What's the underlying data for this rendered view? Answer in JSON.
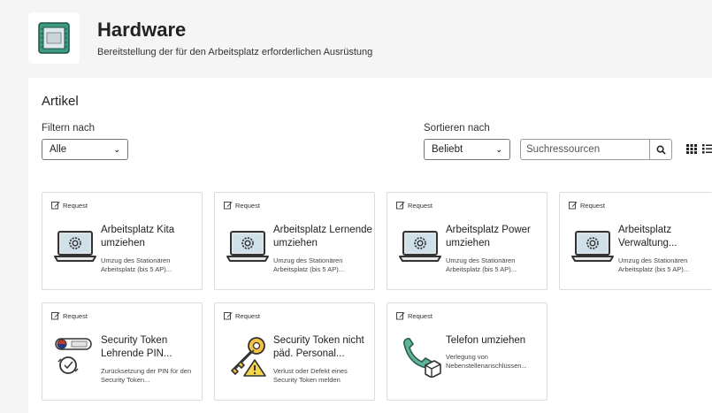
{
  "header": {
    "title": "Hardware",
    "subtitle": "Bereitstellung der für den Arbeitsplatz erforderlichen Ausrüstung",
    "icon": "chip-icon"
  },
  "section": {
    "title": "Artikel",
    "filter_label": "Filtern nach",
    "filter_value": "Alle",
    "sort_label": "Sortieren nach",
    "sort_value": "Beliebt",
    "search_placeholder": "Suchressourcen"
  },
  "cards": [
    {
      "badge": "Request",
      "title": "Arbeitsplatz Kita umziehen",
      "desc": "Umzug des Stationären Arbeitsplatz (bis 5 AP)...",
      "icon": "laptop-gear-icon"
    },
    {
      "badge": "Request",
      "title": "Arbeitsplatz Lernende umziehen",
      "desc": "Umzug des Stationären Arbeitsplatz (bis 5 AP)...",
      "icon": "laptop-gear-icon"
    },
    {
      "badge": "Request",
      "title": "Arbeitsplatz Power umziehen",
      "desc": "Umzug des Stationären Arbeitsplatz (bis 5 AP)...",
      "icon": "laptop-gear-icon"
    },
    {
      "badge": "Request",
      "title": "Arbeitsplatz Verwaltung...",
      "desc": "Umzug des Stationären Arbeitsplatz (bis 5 AP)...",
      "icon": "laptop-gear-icon"
    },
    {
      "badge": "Request",
      "title": "Security Token Lehrende PIN...",
      "desc": "Zurücksetzung der PIN für den Security Token...",
      "icon": "security-token-icon"
    },
    {
      "badge": "Request",
      "title": "Security Token nicht päd. Personal...",
      "desc": "Verlust oder Defekt eines Security Token melden",
      "icon": "key-warning-icon"
    },
    {
      "badge": "Request",
      "title": "Telefon umziehen",
      "desc": "Verlegung von Nebenstellenanschlüssen...",
      "icon": "phone-box-icon"
    }
  ],
  "colors": {
    "accent": "#2e7d6b",
    "panel_bg": "#ffffff",
    "page_bg": "#f5f5f5"
  }
}
